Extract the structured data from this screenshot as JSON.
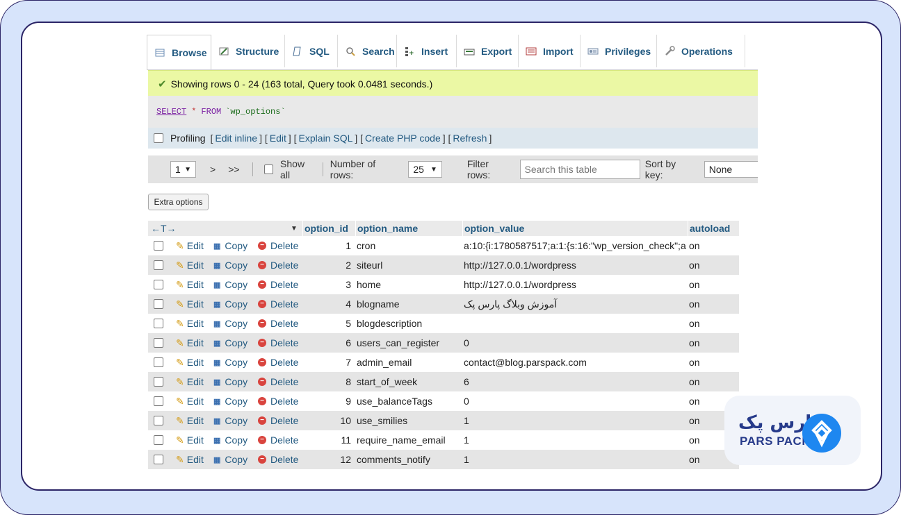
{
  "tabs": [
    {
      "label": "Browse",
      "icon": "table-icon"
    },
    {
      "label": "Structure",
      "icon": "structure-icon"
    },
    {
      "label": "SQL",
      "icon": "sql-icon"
    },
    {
      "label": "Search",
      "icon": "search-icon"
    },
    {
      "label": "Insert",
      "icon": "insert-icon"
    },
    {
      "label": "Export",
      "icon": "export-icon"
    },
    {
      "label": "Import",
      "icon": "import-icon"
    },
    {
      "label": "Privileges",
      "icon": "privileges-icon"
    },
    {
      "label": "Operations",
      "icon": "wrench-icon"
    }
  ],
  "message": "Showing rows 0 - 24 (163 total, Query took 0.0481 seconds.)",
  "sql": {
    "select": "SELECT",
    "star": "*",
    "from": "FROM",
    "table": "`wp_options`"
  },
  "profiling": {
    "label": "Profiling",
    "links": [
      "Edit inline",
      "Edit",
      "Explain SQL",
      "Create PHP code",
      "Refresh"
    ]
  },
  "nav": {
    "page": "1",
    "next": ">",
    "last": ">>",
    "show_all": "Show all",
    "rows_label": "Number of rows:",
    "rows_value": "25",
    "filter_label": "Filter rows:",
    "filter_placeholder": "Search this table",
    "sort_label": "Sort by key:",
    "sort_value": "None"
  },
  "extra_options": "Extra options",
  "table": {
    "arrows": "←T→",
    "columns": [
      "option_id",
      "option_name",
      "option_value",
      "autoload"
    ],
    "actions": {
      "edit": "Edit",
      "copy": "Copy",
      "delete": "Delete"
    },
    "rows": [
      {
        "id": "1",
        "name": "cron",
        "value": "a:10:{i:1780587517;a:1:{s:16:\"wp_version_check\";a:...",
        "autoload": "on"
      },
      {
        "id": "2",
        "name": "siteurl",
        "value": "http://127.0.0.1/wordpress",
        "autoload": "on"
      },
      {
        "id": "3",
        "name": "home",
        "value": "http://127.0.0.1/wordpress",
        "autoload": "on"
      },
      {
        "id": "4",
        "name": "blogname",
        "value": "آموزش وبلاگ پارس پک",
        "autoload": "on"
      },
      {
        "id": "5",
        "name": "blogdescription",
        "value": "",
        "autoload": "on"
      },
      {
        "id": "6",
        "name": "users_can_register",
        "value": "0",
        "autoload": "on"
      },
      {
        "id": "7",
        "name": "admin_email",
        "value": "contact@blog.parspack.com",
        "autoload": "on"
      },
      {
        "id": "8",
        "name": "start_of_week",
        "value": "6",
        "autoload": "on"
      },
      {
        "id": "9",
        "name": "use_balanceTags",
        "value": "0",
        "autoload": "on"
      },
      {
        "id": "10",
        "name": "use_smilies",
        "value": "1",
        "autoload": "on"
      },
      {
        "id": "11",
        "name": "require_name_email",
        "value": "1",
        "autoload": "on"
      },
      {
        "id": "12",
        "name": "comments_notify",
        "value": "1",
        "autoload": "on"
      }
    ]
  },
  "logo": {
    "fa": "پارس پک",
    "en": "PARS PACK"
  },
  "colors": {
    "link": "#235a81",
    "success_bg": "#ebf8a4",
    "frame": "#d7e4fb",
    "brand": "#1e87f0"
  }
}
